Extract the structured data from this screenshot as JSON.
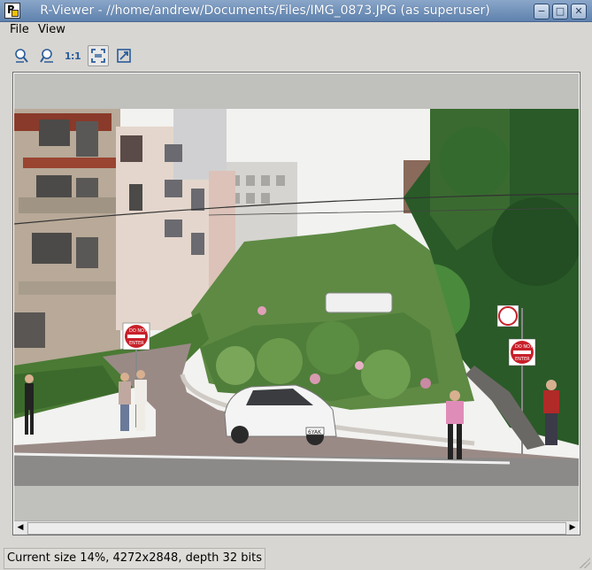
{
  "window": {
    "title": "R-Viewer - //home/andrew/Documents/Files/IMG_0873.JPG (as superuser)",
    "icon": "r-viewer-app-icon",
    "controls": [
      "minimize-icon",
      "maximize-icon",
      "close-icon"
    ]
  },
  "menu": {
    "file": "File",
    "view": "View"
  },
  "toolbar": {
    "buttons": [
      "zoom-in-icon",
      "zoom-out-icon",
      "actual-size-icon",
      "fit-window-icon",
      "fullscreen-icon"
    ],
    "actual_size_label": "1:1"
  },
  "image": {
    "description_icon": "photo-lombard-street",
    "signs": {
      "do_not_enter_top": "DO NOT",
      "do_not_enter_bottom": "ENTER",
      "plate": "6YAK"
    }
  },
  "status": {
    "text": "Current size 14%, 4272x2848, depth 32 bits"
  },
  "colors": {
    "titlebar": "#6f8fb8",
    "background": "#d8d6d2",
    "canvas": "#c0c0bc"
  }
}
